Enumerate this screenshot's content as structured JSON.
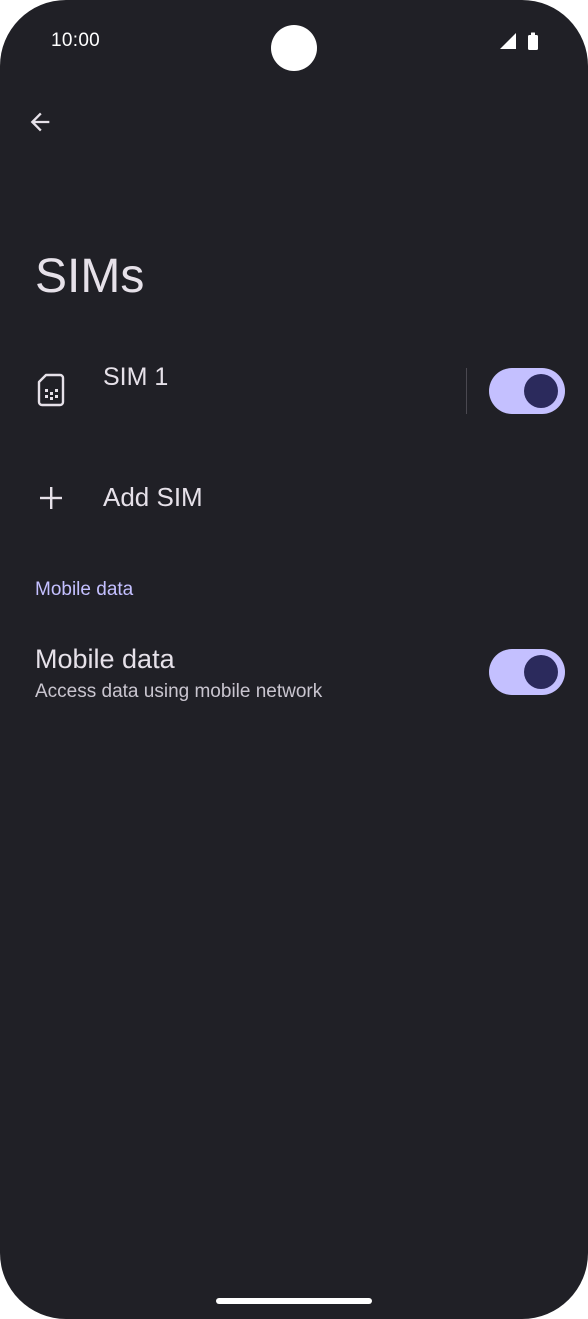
{
  "status_bar": {
    "time": "10:00",
    "icons": [
      "signal-icon",
      "battery-icon"
    ]
  },
  "toolbar": {
    "back_icon": "arrow-left-icon"
  },
  "page": {
    "title": "SIMs"
  },
  "sims": [
    {
      "label": "SIM 1",
      "icon": "sim-card-icon",
      "enabled": true
    }
  ],
  "add_sim": {
    "label": "Add SIM",
    "icon": "plus-icon"
  },
  "mobile_data_section": {
    "header": "Mobile data",
    "item": {
      "title": "Mobile data",
      "summary": "Access data using mobile network",
      "enabled": true
    }
  },
  "colors": {
    "background": "#202026",
    "accent": "#c4c0ff",
    "toggle_thumb": "#2b2a5c",
    "text_primary": "#e6e1e9",
    "text_secondary": "#c9c5cf"
  }
}
